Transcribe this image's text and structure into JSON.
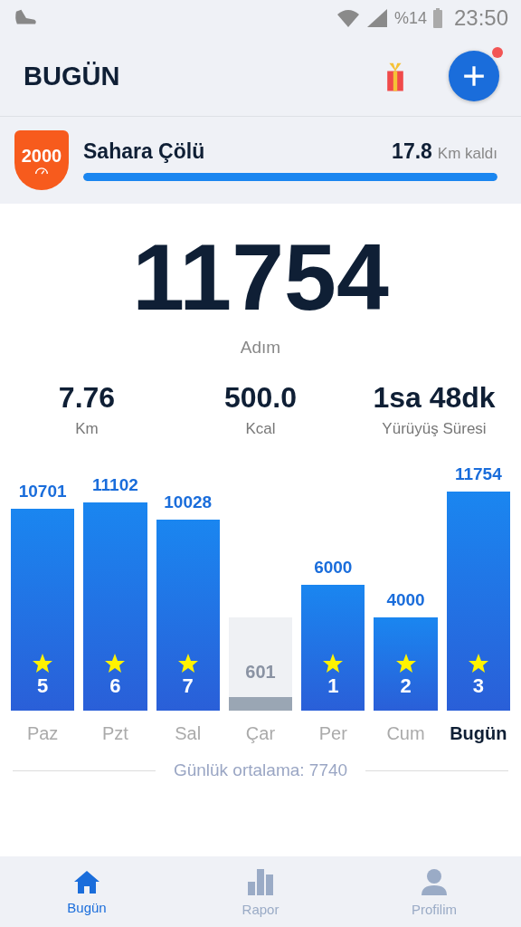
{
  "status_bar": {
    "battery": "%14",
    "time": "23:50"
  },
  "header": {
    "title": "BUGÜN",
    "notification": true
  },
  "challenge": {
    "badge": "2000",
    "name": "Sahara Çölü",
    "remaining": "17.8",
    "unit": "Km kaldı",
    "level": 1
  },
  "steps": {
    "value": "11754",
    "label": "Adım"
  },
  "stats": [
    {
      "value": "7.76",
      "label": "Km"
    },
    {
      "value": "500.0",
      "label": "Kcal"
    },
    {
      "value": "1sa 48dk",
      "label": "Yürüyüş Süresi"
    }
  ],
  "days": [
    {
      "label": "Paz",
      "steps": "10701",
      "rank": "5",
      "goal_met": true,
      "selected": false
    },
    {
      "label": "Pzt",
      "steps": "11102",
      "rank": "6",
      "goal_met": true,
      "selected": false
    },
    {
      "label": "Sal",
      "steps": "10028",
      "rank": "7",
      "goal_met": true,
      "selected": false
    },
    {
      "label": "Çar",
      "steps": "601",
      "goal_met": false,
      "selected": false
    },
    {
      "label": "Per",
      "steps": "6000",
      "rank": "1",
      "goal_met": true,
      "selected": false
    },
    {
      "label": "Cum",
      "steps": "4000",
      "rank": "2",
      "goal_met": true,
      "selected": false
    },
    {
      "label": "Bugün",
      "steps": "11754",
      "rank": "3",
      "goal_met": true,
      "selected": true
    }
  ],
  "average": "Günlük ortalama: 7740",
  "nav": [
    {
      "kind": "home",
      "label": "Bugün",
      "selected": true
    },
    {
      "kind": "report",
      "label": "Rapor",
      "selected": false
    },
    {
      "kind": "profile",
      "label": "Profilim",
      "selected": false
    }
  ]
}
